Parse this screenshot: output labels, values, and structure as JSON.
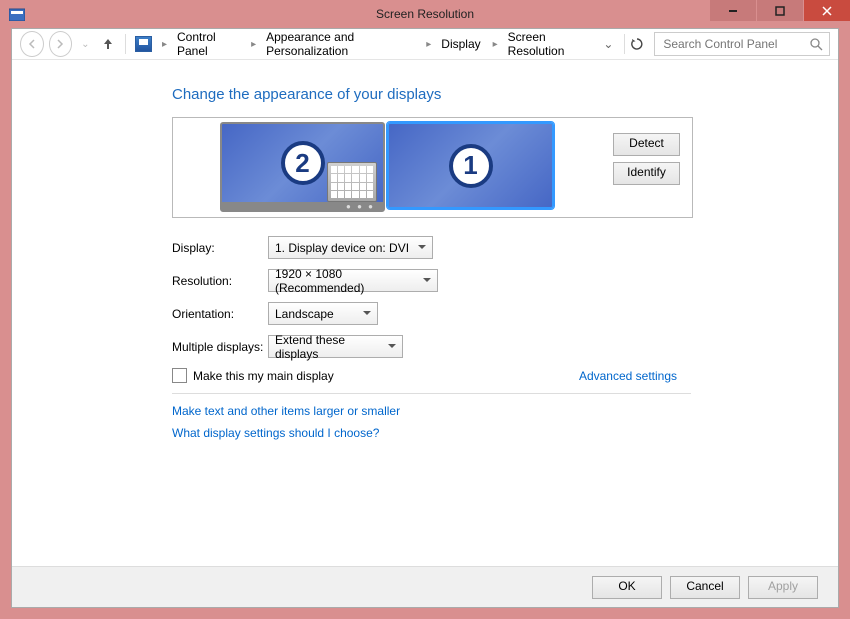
{
  "titlebar": {
    "title": "Screen Resolution"
  },
  "breadcrumbs": {
    "items": [
      "Control Panel",
      "Appearance and Personalization",
      "Display",
      "Screen Resolution"
    ]
  },
  "search": {
    "placeholder": "Search Control Panel"
  },
  "heading": "Change the appearance of your displays",
  "monitors": {
    "one": "1",
    "two": "2",
    "detect": "Detect",
    "identify": "Identify"
  },
  "form": {
    "display_label": "Display:",
    "display_value": "1. Display device on: DVI",
    "resolution_label": "Resolution:",
    "resolution_value": "1920 × 1080 (Recommended)",
    "orientation_label": "Orientation:",
    "orientation_value": "Landscape",
    "multiple_label": "Multiple displays:",
    "multiple_value": "Extend these displays",
    "main_checkbox": "Make this my main display",
    "advanced": "Advanced settings"
  },
  "links": {
    "larger": "Make text and other items larger or smaller",
    "which": "What display settings should I choose?"
  },
  "buttons": {
    "ok": "OK",
    "cancel": "Cancel",
    "apply": "Apply"
  }
}
